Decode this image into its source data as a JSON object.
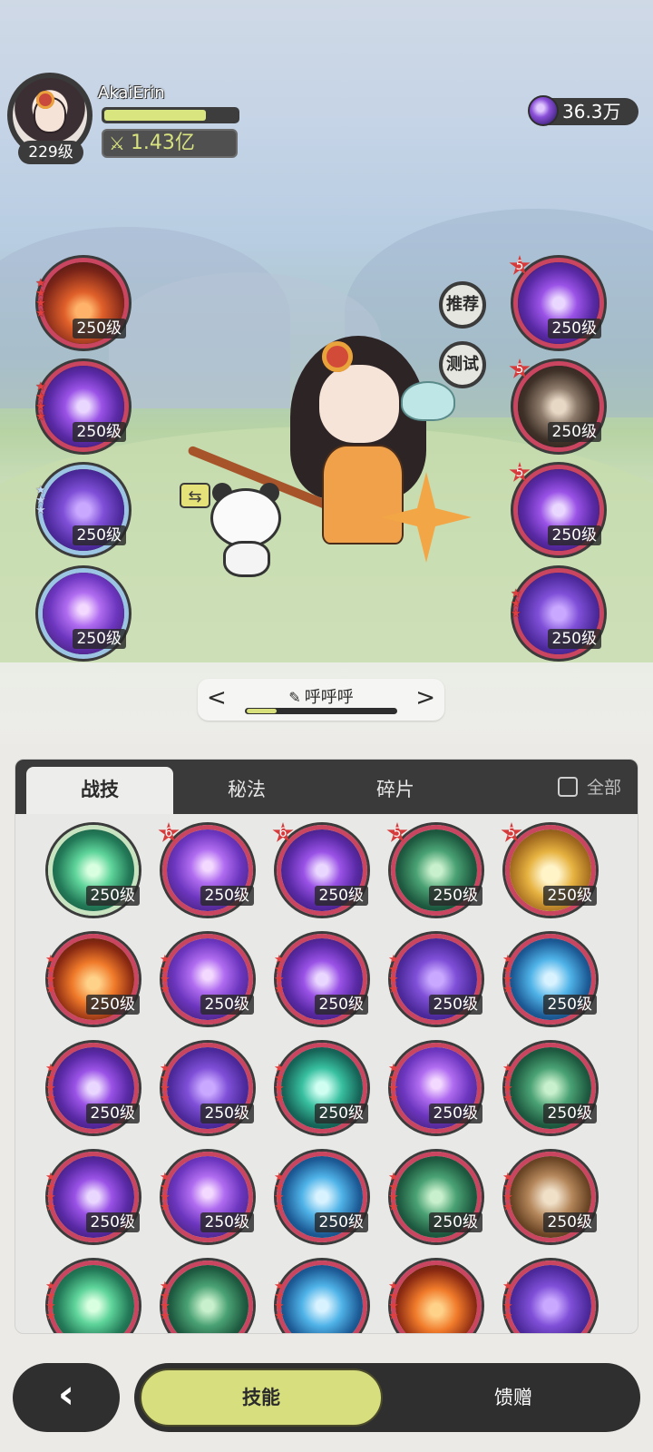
{
  "player": {
    "name": "AkaiErin",
    "level": "229级",
    "hp_fraction": 0.77,
    "power": "1.43亿",
    "currency": "36.3万"
  },
  "side_buttons": {
    "recommend": "推荐",
    "test": "测试"
  },
  "equipped_left": [
    {
      "level": "250级",
      "stars": 4,
      "art": "fire"
    },
    {
      "level": "250级",
      "stars": 4,
      "art": "violet"
    },
    {
      "level": "250级",
      "stars": 3,
      "art": "lilac",
      "frame": "blue"
    },
    {
      "level": "250级",
      "stars": 0,
      "art": "violet2",
      "frame": "blue"
    }
  ],
  "equipped_right": [
    {
      "level": "250级",
      "rank": "5",
      "art": "violet"
    },
    {
      "level": "250级",
      "rank": "5",
      "art": "brown"
    },
    {
      "level": "250级",
      "rank": "5",
      "art": "violet"
    },
    {
      "level": "250级",
      "stars": 3,
      "art": "lilac"
    }
  ],
  "preset": {
    "name": "呼呼呼",
    "progress": 0.2
  },
  "tabs": {
    "tab1": "战技",
    "tab2": "秘法",
    "tab3": "碎片",
    "all_label": "全部"
  },
  "skills": [
    {
      "level": "250级",
      "art": "greenlight",
      "frame": "green"
    },
    {
      "level": "250级",
      "rank": "6",
      "art": "violet2"
    },
    {
      "level": "250级",
      "rank": "6",
      "art": "violet"
    },
    {
      "level": "250级",
      "rank": "5",
      "art": "green"
    },
    {
      "level": "250级",
      "rank": "5",
      "art": "gold"
    },
    {
      "level": "250级",
      "stars": 4,
      "art": "orangefire"
    },
    {
      "level": "250级",
      "stars": 4,
      "art": "violet2"
    },
    {
      "level": "250级",
      "stars": 4,
      "art": "violet"
    },
    {
      "level": "250级",
      "stars": 4,
      "art": "lilac"
    },
    {
      "level": "250级",
      "stars": 4,
      "art": "blue"
    },
    {
      "level": "250级",
      "stars": 4,
      "art": "violet"
    },
    {
      "level": "250级",
      "stars": 4,
      "art": "lilac"
    },
    {
      "level": "250级",
      "stars": 4,
      "art": "teal"
    },
    {
      "level": "250级",
      "stars": 4,
      "art": "violet2"
    },
    {
      "level": "250级",
      "stars": 4,
      "art": "green"
    },
    {
      "level": "250级",
      "stars": 4,
      "art": "violet"
    },
    {
      "level": "250级",
      "stars": 4,
      "art": "violet2"
    },
    {
      "level": "250级",
      "stars": 4,
      "art": "blue"
    },
    {
      "level": "250级",
      "stars": 4,
      "art": "green"
    },
    {
      "level": "250级",
      "stars": 4,
      "art": "tan"
    },
    {
      "level": "",
      "stars": 4,
      "art": "greenlight"
    },
    {
      "level": "",
      "stars": 4,
      "art": "green"
    },
    {
      "level": "",
      "stars": 4,
      "art": "blue"
    },
    {
      "level": "",
      "stars": 4,
      "art": "orangefire"
    },
    {
      "level": "",
      "stars": 4,
      "art": "lilac"
    }
  ],
  "bottom_bar": {
    "back_icon": "‹",
    "active": "技能",
    "other": "馈赠"
  }
}
